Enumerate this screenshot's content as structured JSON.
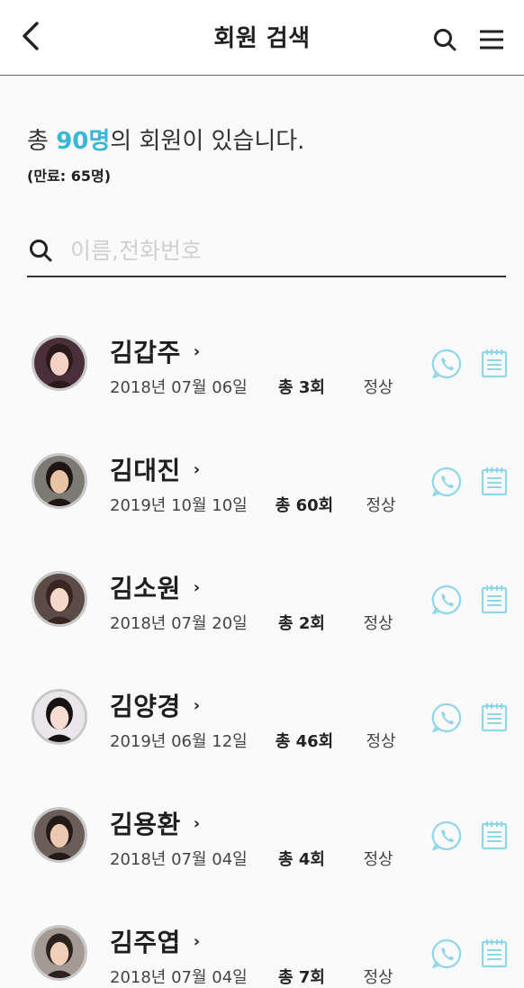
{
  "header": {
    "title": "회원 검색",
    "back_icon": "chevron-left-icon",
    "search_icon": "search-icon",
    "menu_icon": "hamburger-menu-icon"
  },
  "summary": {
    "prefix": "총 ",
    "count": "90명",
    "suffix": "의 회원이 있습니다.",
    "expired": "(만료: 65명)"
  },
  "search": {
    "placeholder": "이름,전화번호",
    "value": ""
  },
  "colors": {
    "accent": "#3ab6d6",
    "icon_tint": "#8fd6ea"
  },
  "members": [
    {
      "name": "김갑주",
      "date": "2018년 07월 06일",
      "total": "총 3회",
      "status": "정상"
    },
    {
      "name": "김대진",
      "date": "2019년 10월 10일",
      "total": "총 60회",
      "status": "정상"
    },
    {
      "name": "김소원",
      "date": "2018년 07월 20일",
      "total": "총 2회",
      "status": "정상"
    },
    {
      "name": "김양경",
      "date": "2019년 06월 12일",
      "total": "총 46회",
      "status": "정상"
    },
    {
      "name": "김용환",
      "date": "2018년 07월 04일",
      "total": "총 4회",
      "status": "정상"
    },
    {
      "name": "김주엽",
      "date": "2018년 07월 04일",
      "total": "총 7회",
      "status": "정상"
    }
  ]
}
